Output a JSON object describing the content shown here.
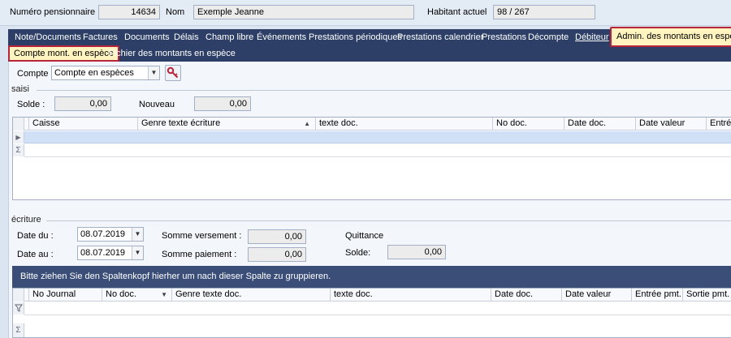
{
  "header": {
    "pensioner_label": "Numéro pensionnaire",
    "pensioner_value": "14634",
    "name_label": "Nom",
    "name_value": "Exemple Jeanne",
    "resident_label": "Habitant actuel",
    "resident_value": "98 / 267"
  },
  "tabs": [
    {
      "label": "Note/Documents"
    },
    {
      "label": "Factures"
    },
    {
      "label": "Documents"
    },
    {
      "label": "Délais"
    },
    {
      "label": "Champ libre"
    },
    {
      "label": "Événements"
    },
    {
      "label": "Prestations périodiques"
    },
    {
      "label": "Prestations calendrier"
    },
    {
      "label": "Prestations"
    },
    {
      "label": "Décompte"
    },
    {
      "label": "Débiteur"
    },
    {
      "label": "Admin. des montants en espèce"
    }
  ],
  "subtabs": [
    {
      "label": "Compte mont. en espèce"
    },
    {
      "label": "Fichier des montants en espèce"
    }
  ],
  "account": {
    "label": "Compte",
    "value": "Compte en espèces"
  },
  "saisi": {
    "legend": "saisi",
    "solde_label": "Solde :",
    "solde_value": "0,00",
    "nouveau_label": "Nouveau",
    "nouveau_value": "0,00"
  },
  "grid1": {
    "columns": [
      "Caisse",
      "Genre texte écriture",
      "texte doc.",
      "No doc.",
      "Date doc.",
      "Date valeur",
      "Entrée"
    ],
    "sort_icon": "▲"
  },
  "ecriture": {
    "legend": "écriture",
    "date_du_label": "Date du :",
    "date_du_value": "08.07.2019",
    "date_au_label": "Date au :",
    "date_au_value": "08.07.2019",
    "somme_versement_label": "Somme versement :",
    "somme_versement_value": "0,00",
    "somme_paiement_label": "Somme paiement :",
    "somme_paiement_value": "0,00",
    "quittance_label": "Quittance",
    "solde_label": "Solde:",
    "solde_value": "0,00"
  },
  "grid2": {
    "group_hint": "Bitte ziehen Sie den Spaltenkopf hierher um nach dieser Spalte zu gruppieren.",
    "columns": [
      "No Journal",
      "No doc.",
      "Genre texte doc.",
      "texte doc.",
      "Date doc.",
      "Date valeur",
      "Entrée pmt.",
      "Sortie pmt."
    ],
    "filter_icon": "▼"
  }
}
